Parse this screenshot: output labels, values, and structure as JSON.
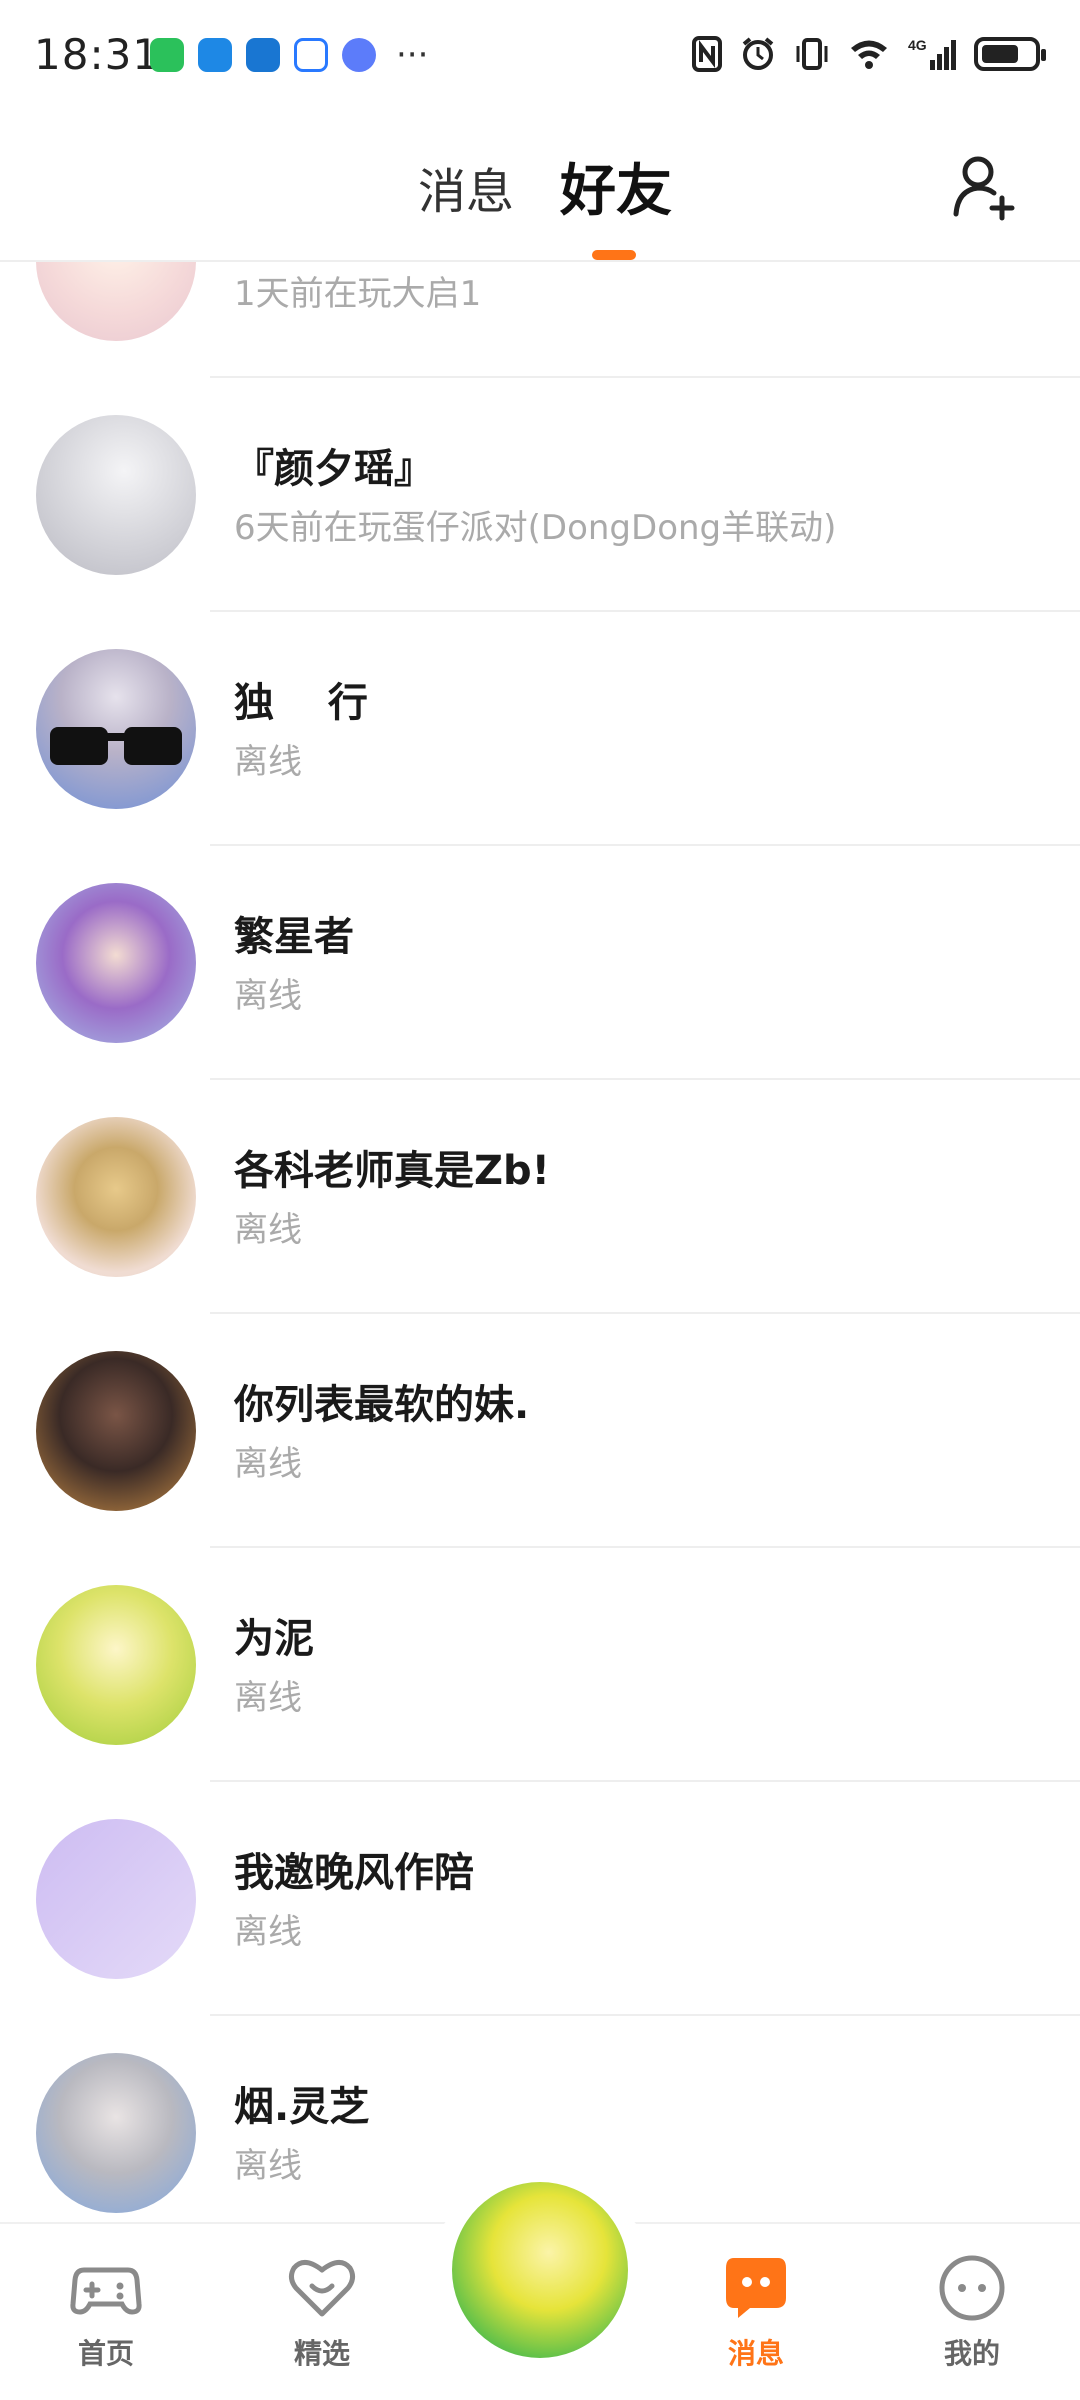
{
  "status_bar": {
    "time": "18:31",
    "more": "···"
  },
  "header": {
    "tabs": [
      {
        "label": "消息",
        "active": false
      },
      {
        "label": "好友",
        "active": true
      }
    ],
    "accent": "#ff7417"
  },
  "friends": [
    {
      "name": "",
      "status": "1天前在玩大启1"
    },
    {
      "name": "『颜夕瑶』",
      "status": "6天前在玩蛋仔派对(DongDong羊联动)"
    },
    {
      "name": "独　 行",
      "status": "离线"
    },
    {
      "name": "繁星者",
      "status": "离线"
    },
    {
      "name": "各科老师真是Zb!",
      "status": "离线"
    },
    {
      "name": "你列表最软的妹.",
      "status": "离线"
    },
    {
      "name": "为泥",
      "status": "离线"
    },
    {
      "name": "我邀晚风作陪",
      "status": "离线"
    },
    {
      "name": "烟.灵芝",
      "status": "离线"
    }
  ],
  "bottom_nav": [
    {
      "label": "首页",
      "icon": "gamepad-icon",
      "active": false
    },
    {
      "label": "精选",
      "icon": "heart-icon",
      "active": false
    },
    {
      "label": "消息",
      "icon": "chat-bubble-icon",
      "active": true
    },
    {
      "label": "我的",
      "icon": "face-icon",
      "active": false
    }
  ]
}
